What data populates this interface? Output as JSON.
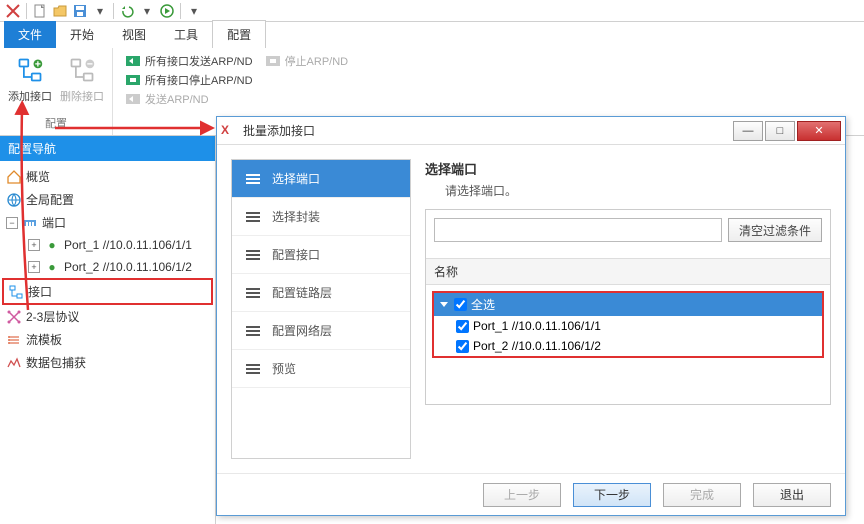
{
  "colors": {
    "accent": "#1e7fd6",
    "danger": "#e03030"
  },
  "topbar_icons": [
    "logo-x-icon",
    "new-file-icon",
    "open-folder-icon",
    "save-icon",
    "save-dropdown-icon",
    "undo-icon",
    "redo-icon",
    "run-icon",
    "overflow-icon"
  ],
  "menu": {
    "tabs": [
      "文件",
      "开始",
      "视图",
      "工具",
      "配置"
    ],
    "active_index": 0,
    "selected_index": 4
  },
  "ribbon": {
    "group1": {
      "name": "配置",
      "buttons": [
        {
          "label": "添加接口",
          "enabled": true,
          "data_name": "add-interface-button"
        },
        {
          "label": "删除接口",
          "enabled": false,
          "data_name": "delete-interface-button"
        }
      ]
    },
    "group2": {
      "items": [
        {
          "label": "所有接口发送ARP/ND",
          "enabled": true
        },
        {
          "label": "所有接口停止ARP/ND",
          "enabled": true
        },
        {
          "label": "发送ARP/ND",
          "enabled": false
        }
      ],
      "extra": {
        "label": "停止ARP/ND",
        "enabled": false
      }
    }
  },
  "nav": {
    "header": "配置导航",
    "tree": [
      {
        "icon": "home-icon",
        "label": "概览",
        "indent": 0
      },
      {
        "icon": "globe-icon",
        "label": "全局配置",
        "indent": 0
      },
      {
        "toggle": "-",
        "icon": "port-icon",
        "label": "端口",
        "indent": 0
      },
      {
        "bullet": true,
        "label": "Port_1 //10.0.11.106/1/1",
        "indent": 2
      },
      {
        "bullet": true,
        "label": "Port_2 //10.0.11.106/1/2",
        "indent": 2
      },
      {
        "icon": "interface-icon",
        "label": "接口",
        "indent": 0,
        "selected": true
      },
      {
        "icon": "protocol-icon",
        "label": "2-3层协议",
        "indent": 0
      },
      {
        "icon": "template-icon",
        "label": "流模板",
        "indent": 0
      },
      {
        "icon": "capture-icon",
        "label": "数据包捕获",
        "indent": 0
      }
    ]
  },
  "dialog": {
    "title": "批量添加接口",
    "steps": [
      "选择端口",
      "选择封装",
      "配置接口",
      "配置链路层",
      "配置网络层",
      "预览"
    ],
    "active_step_index": 0,
    "right_title": "选择端口",
    "right_desc": "请选择端口。",
    "filter_placeholder": "",
    "filter_btn": "清空过滤条件",
    "port_header": "名称",
    "select_all": "全选",
    "ports": [
      {
        "label": "Port_1 //10.0.11.106/1/1",
        "checked": true
      },
      {
        "label": "Port_2 //10.0.11.106/1/2",
        "checked": true
      }
    ],
    "buttons": {
      "prev": "上一步",
      "next": "下一步",
      "finish": "完成",
      "exit": "退出"
    }
  }
}
